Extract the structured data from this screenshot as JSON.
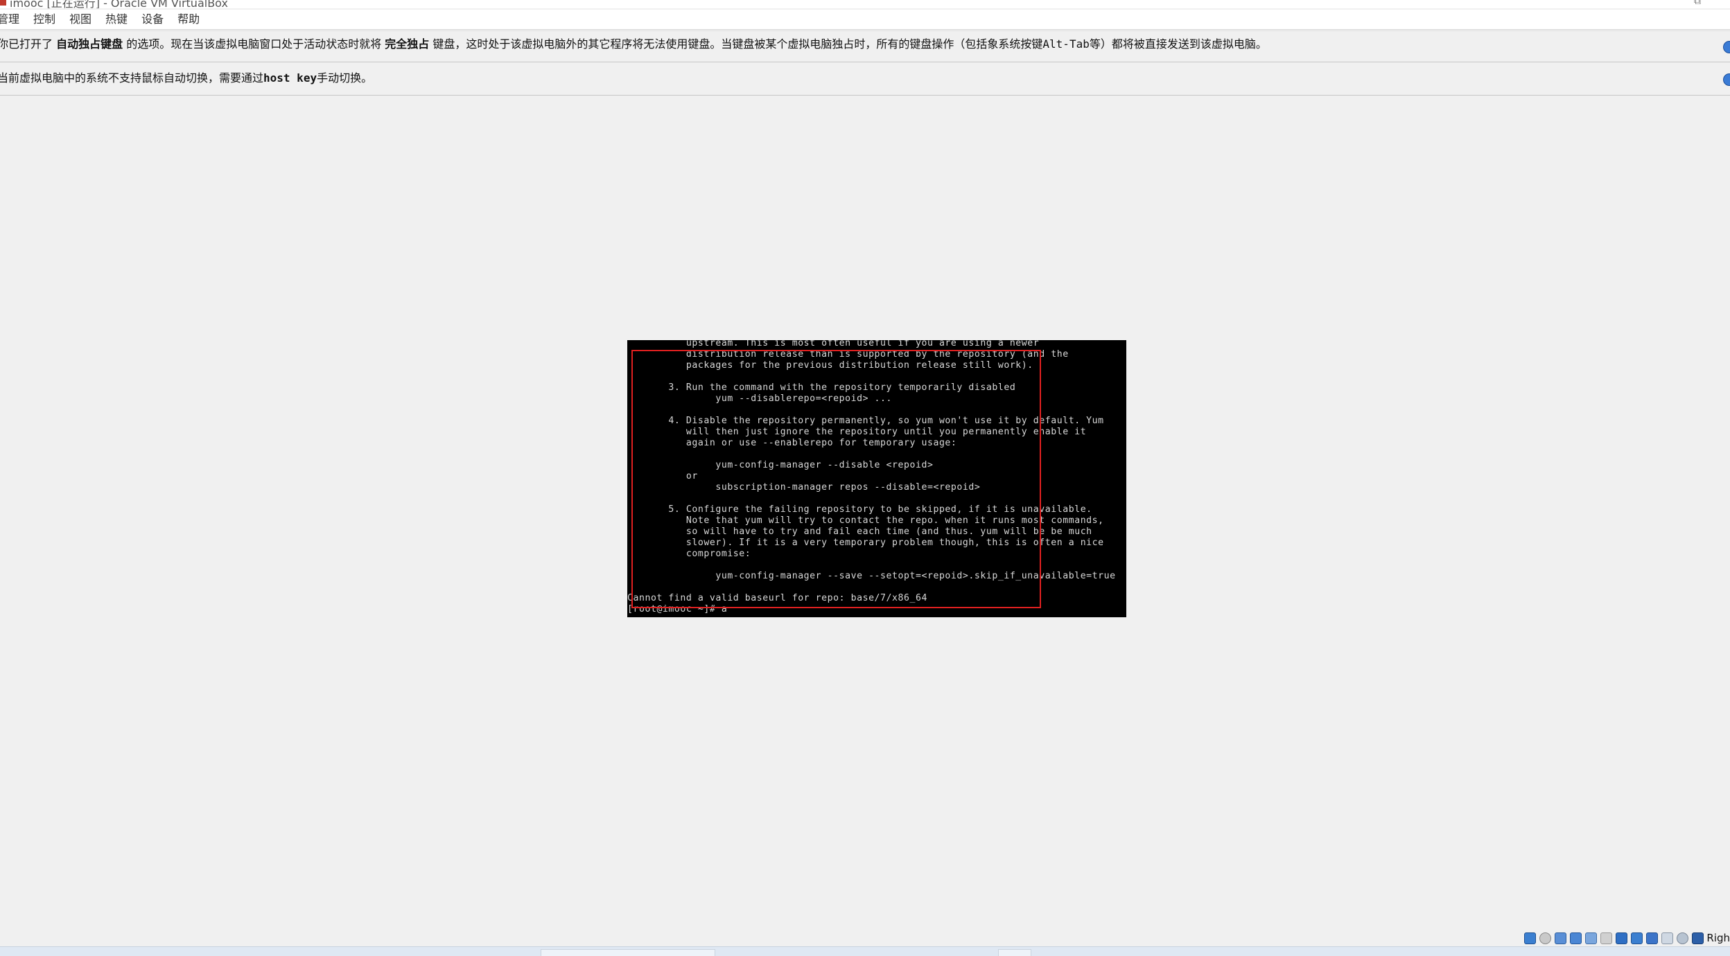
{
  "window": {
    "title": "imooc [正在运行] - Oracle VM VirtualBox"
  },
  "menu": {
    "items": [
      "管理",
      "控制",
      "视图",
      "热键",
      "设备",
      "帮助"
    ]
  },
  "notices": {
    "keyboard": {
      "part1": "你已打开了 ",
      "bold1": "自动独占键盘",
      "part2": " 的选项。现在当该虚拟电脑窗口处于活动状态时就将 ",
      "bold2": "完全独占",
      "part3": " 键盘，这时处于该虚拟电脑外的其它程序将无法使用键盘。当键盘被某个虚拟电脑独占时，所有的键盘操作（包括象系统按键",
      "mono1": "Alt-Tab",
      "part4": "等）都将被直接发送到该虚拟电脑。"
    },
    "mouse": {
      "part1": "当前虚拟电脑中的系统不支持鼠标自动切换，需要通过",
      "bold1": "host key",
      "part2": "手动切换。"
    }
  },
  "console": {
    "lines": [
      "          upstream. This is most often useful if you are using a newer",
      "          distribution release than is supported by the repository (and the",
      "          packages for the previous distribution release still work).",
      "",
      "       3. Run the command with the repository temporarily disabled",
      "               yum --disablerepo=<repoid> ...",
      "",
      "       4. Disable the repository permanently, so yum won't use it by default. Yum",
      "          will then just ignore the repository until you permanently enable it",
      "          again or use --enablerepo for temporary usage:",
      "",
      "               yum-config-manager --disable <repoid>",
      "          or",
      "               subscription-manager repos --disable=<repoid>",
      "",
      "       5. Configure the failing repository to be skipped, if it is unavailable.",
      "          Note that yum will try to contact the repo. when it runs most commands,",
      "          so will have to try and fail each time (and thus. yum will be be much",
      "          slower). If it is a very temporary problem though, this is often a nice",
      "          compromise:",
      "",
      "               yum-config-manager --save --setopt=<repoid>.skip_if_unavailable=true",
      "",
      "Cannot find a valid baseurl for repo: base/7/x86_64",
      "[root@imooc ~]# a"
    ]
  },
  "statusbar": {
    "host_key_label": "Righ"
  }
}
